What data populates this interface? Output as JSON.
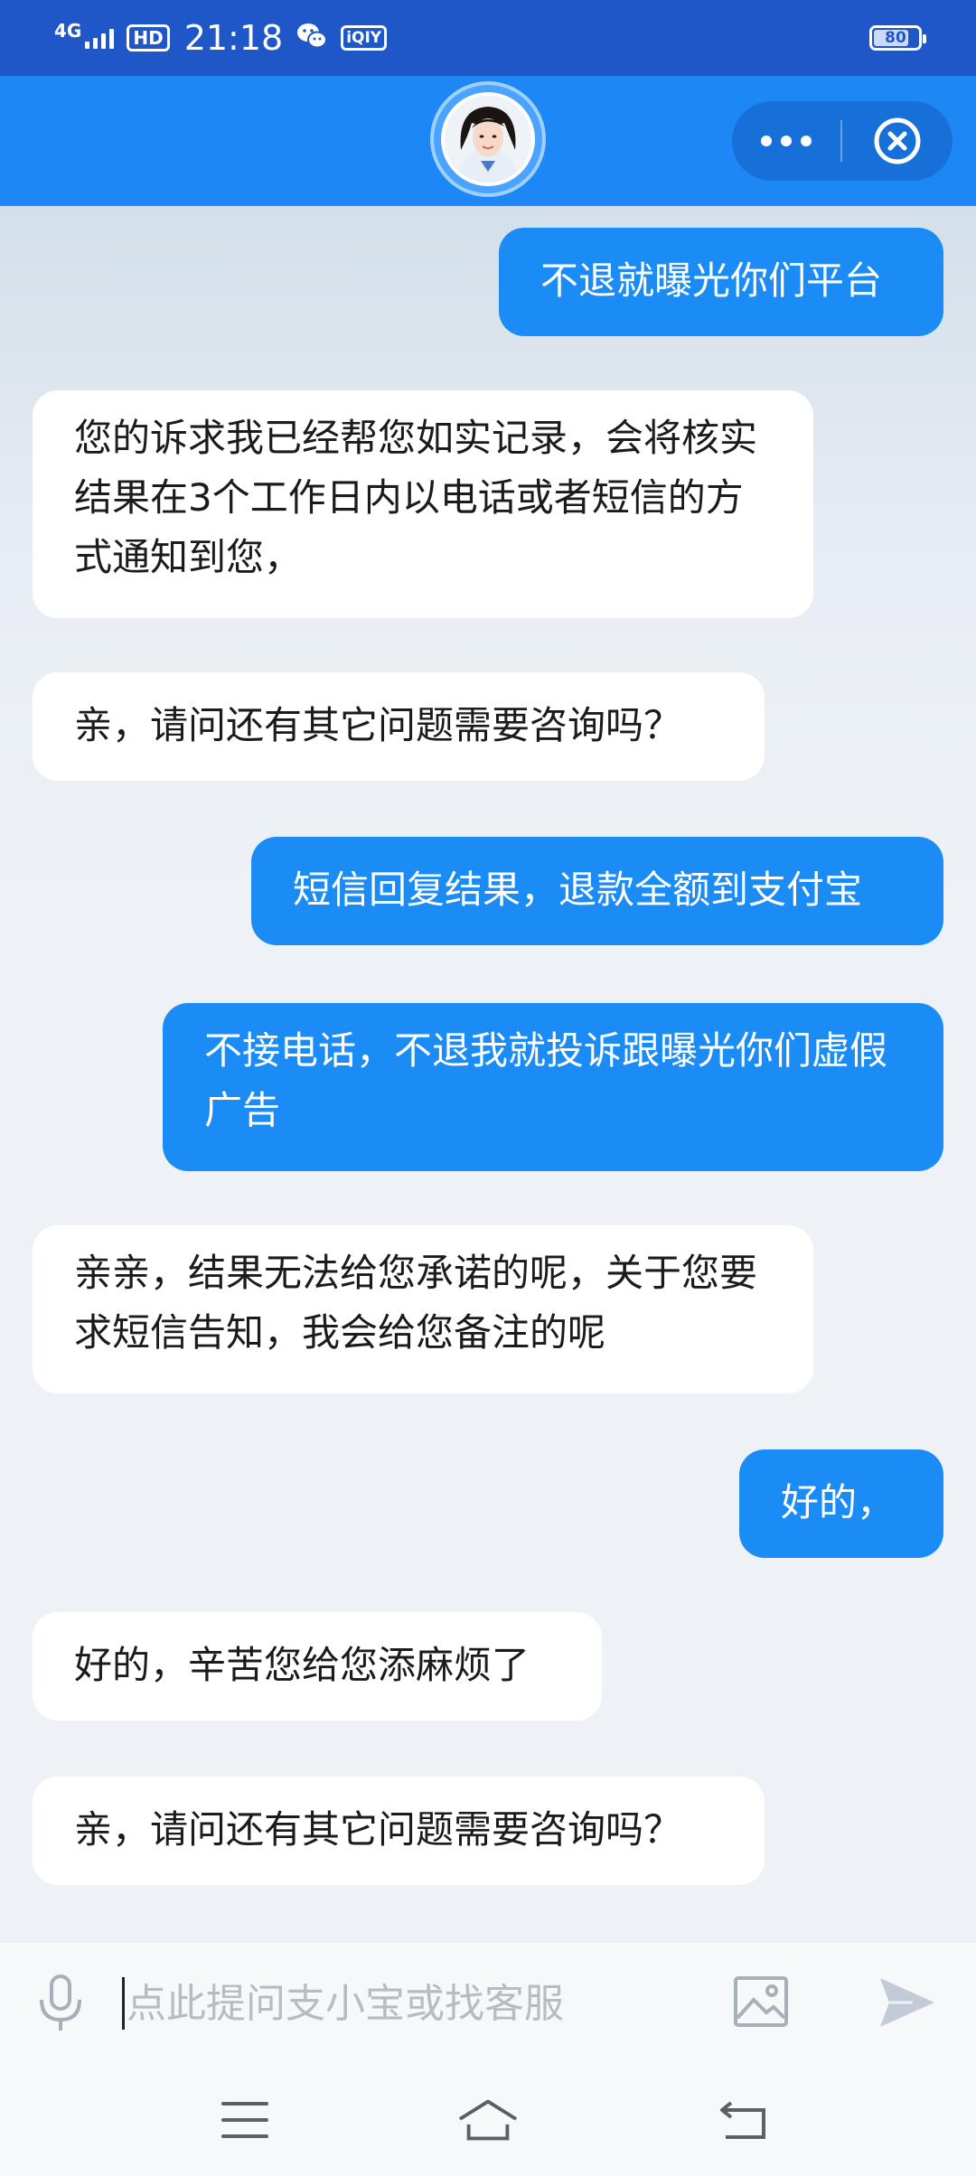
{
  "status_bar": {
    "network": "4G",
    "hd": "HD",
    "time": "21:18",
    "app_badge": "iQIY",
    "battery": "80",
    "battery_level_percent": 80
  },
  "header": {
    "avatar_icon": "assistant-avatar",
    "more_icon": "more-dots-icon",
    "close_icon": "close-circle-icon"
  },
  "messages": [
    {
      "side": "out",
      "text": "不退就曝光你们平台"
    },
    {
      "side": "in",
      "text": "您的诉求我已经帮您如实记录，会将核实结果在3个工作日内以电话或者短信的方式通知到您，"
    },
    {
      "side": "in",
      "text": "亲，请问还有其它问题需要咨询吗？"
    },
    {
      "side": "out",
      "text": "短信回复结果，退款全额到支付宝"
    },
    {
      "side": "out",
      "text": "不接电话，不退我就投诉跟曝光你们虚假广告"
    },
    {
      "side": "in",
      "text": "亲亲，结果无法给您承诺的呢，关于您要求短信告知，我会给您备注的呢"
    },
    {
      "side": "out",
      "text": "好的，"
    },
    {
      "side": "in",
      "text": "好的，辛苦您给您添麻烦了"
    },
    {
      "side": "in",
      "text": "亲，请问还有其它问题需要咨询吗？"
    }
  ],
  "input": {
    "value": "",
    "placeholder": "点此提问支小宝或找客服",
    "mic_icon": "microphone-icon",
    "image_icon": "image-icon",
    "send_icon": "send-icon"
  },
  "nav": {
    "menu_icon": "menu-icon",
    "home_icon": "home-icon",
    "back_icon": "back-icon"
  },
  "colors": {
    "status_bar": "#1f57c8",
    "header": "#1d87f5",
    "outgoing_bubble": "#1b8cf5",
    "incoming_bubble": "#ffffff",
    "chat_background": "#eef2f6"
  }
}
